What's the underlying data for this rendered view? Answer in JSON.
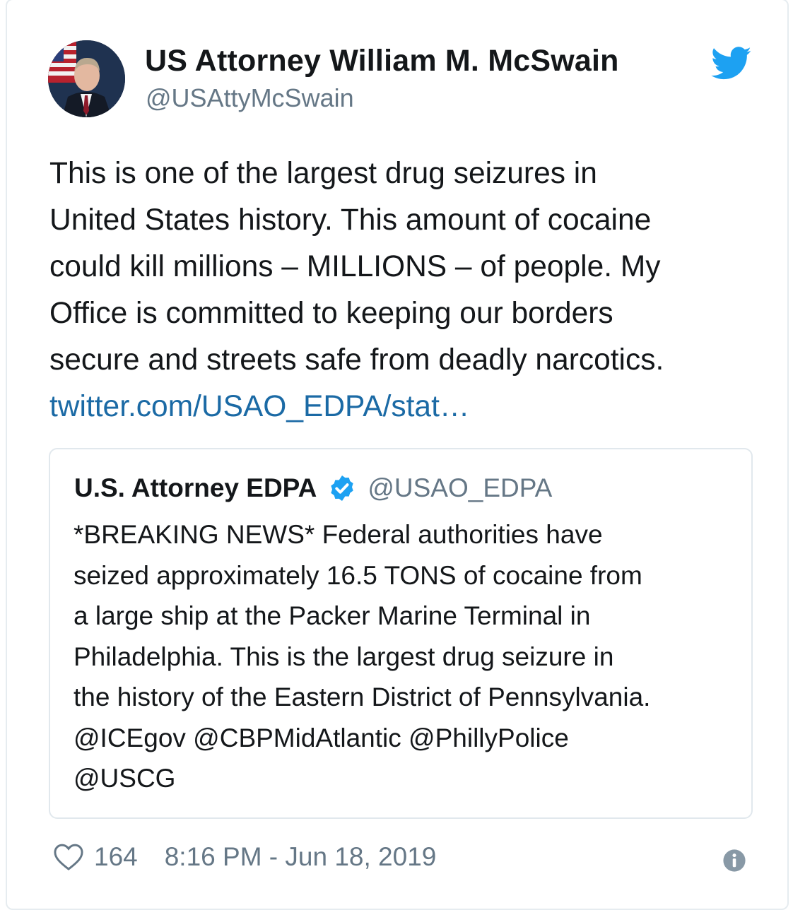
{
  "author": {
    "display_name": "US Attorney William M. McSwain",
    "handle": "@USAttyMcSwain"
  },
  "tweet": {
    "lines": [
      "This is one of the largest drug seizures in",
      "United States history. This amount of cocaine",
      "could kill millions – MILLIONS – of people. My",
      "Office is committed to keeping our borders",
      "secure and streets safe from deadly narcotics."
    ],
    "link_text": "twitter.com/USAO_EDPA/stat…"
  },
  "quoted_tweet": {
    "display_name": "U.S. Attorney EDPA",
    "handle": "@USAO_EDPA",
    "lines": [
      "*BREAKING NEWS* Federal authorities have",
      "seized approximately 16.5 TONS of cocaine from",
      "a large ship at the Packer Marine Terminal in",
      "Philadelphia. This is the largest drug seizure in",
      "the history of the Eastern District of Pennsylvania.",
      "@ICEgov @CBPMidAtlantic @PhillyPolice",
      "@USCG"
    ]
  },
  "footer": {
    "like_count": "164",
    "timestamp": "8:16 PM - Jun 18, 2019"
  },
  "icons": {
    "brand": "twitter-bird-icon",
    "verified": "verified-badge-icon",
    "like": "heart-icon",
    "info": "info-icon"
  },
  "colors": {
    "twitter_blue": "#1da1f2",
    "link": "#1b6aa5",
    "secondary_text": "#657786",
    "border": "#e1e8ed"
  }
}
